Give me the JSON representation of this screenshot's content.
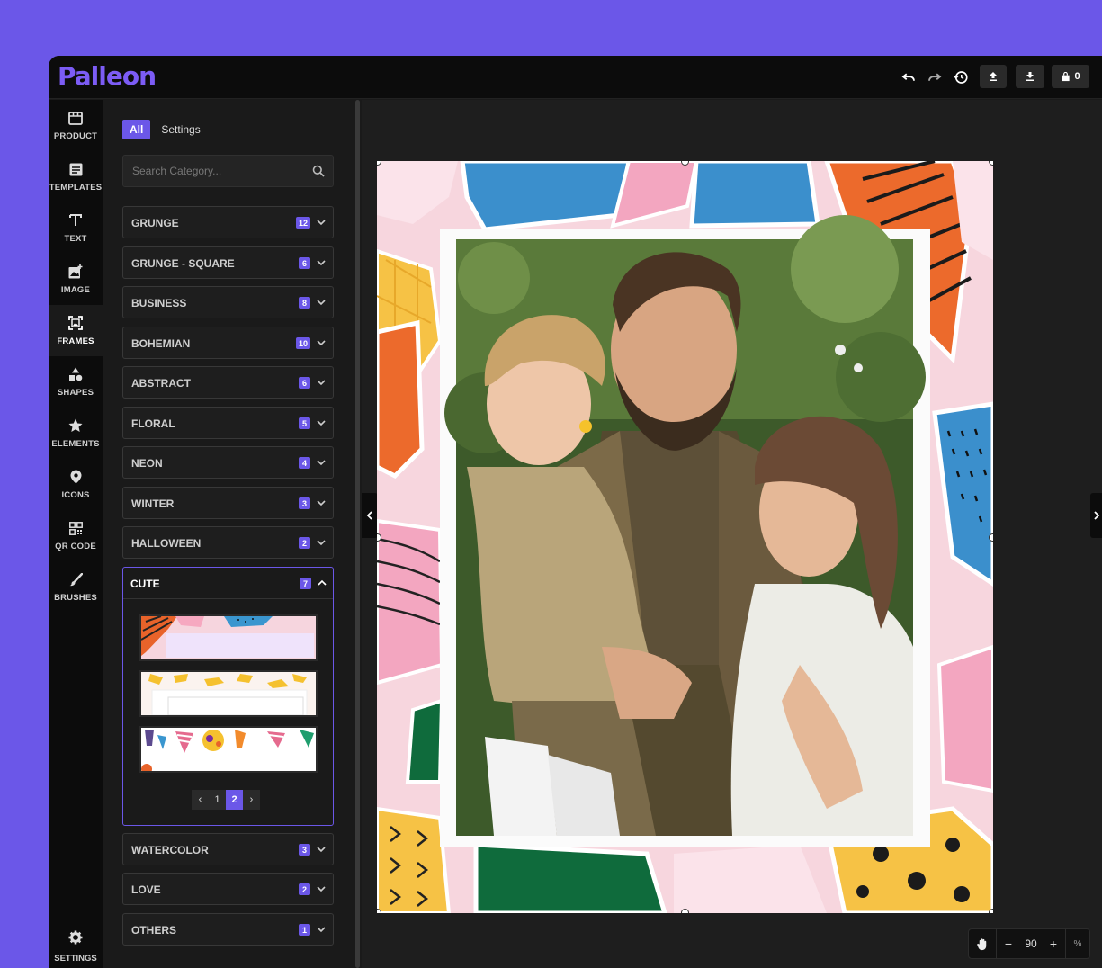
{
  "app": {
    "logo": "Palleon"
  },
  "header": {
    "account_count": "0"
  },
  "sidebar": {
    "items": [
      {
        "label": "PRODUCT",
        "icon": "store-icon"
      },
      {
        "label": "TEMPLATES",
        "icon": "templates-icon"
      },
      {
        "label": "TEXT",
        "icon": "text-icon"
      },
      {
        "label": "IMAGE",
        "icon": "image-icon"
      },
      {
        "label": "FRAMES",
        "icon": "frames-icon"
      },
      {
        "label": "SHAPES",
        "icon": "shapes-icon"
      },
      {
        "label": "ELEMENTS",
        "icon": "star-icon"
      },
      {
        "label": "ICONS",
        "icon": "pin-icon"
      },
      {
        "label": "QR CODE",
        "icon": "qr-icon"
      },
      {
        "label": "BRUSHES",
        "icon": "brush-icon"
      }
    ],
    "active": "FRAMES",
    "settings_label": "SETTINGS"
  },
  "panel": {
    "tabs": [
      "All",
      "Settings"
    ],
    "search_placeholder": "Search Category...",
    "categories": [
      {
        "label": "GRUNGE",
        "count": "12"
      },
      {
        "label": "GRUNGE - SQUARE",
        "count": "6"
      },
      {
        "label": "BUSINESS",
        "count": "8"
      },
      {
        "label": "BOHEMIAN",
        "count": "10"
      },
      {
        "label": "ABSTRACT",
        "count": "6"
      },
      {
        "label": "FLORAL",
        "count": "5"
      },
      {
        "label": "NEON",
        "count": "4"
      },
      {
        "label": "WINTER",
        "count": "3"
      },
      {
        "label": "HALLOWEEN",
        "count": "2"
      }
    ],
    "open_category": {
      "label": "CUTE",
      "count": "7"
    },
    "pagination": {
      "prev": "‹",
      "pages": [
        "1",
        "2"
      ],
      "current": "2",
      "next": "›"
    },
    "categories_after": [
      {
        "label": "WATERCOLOR",
        "count": "3"
      },
      {
        "label": "LOVE",
        "count": "2"
      },
      {
        "label": "OTHERS",
        "count": "1"
      }
    ]
  },
  "zoom": {
    "minus": "−",
    "value": "90",
    "plus": "+",
    "unit": "%"
  },
  "colors": {
    "accent": "#6b57e8",
    "background": "#1a1a1a",
    "frame_pink": "#f7d6de"
  }
}
